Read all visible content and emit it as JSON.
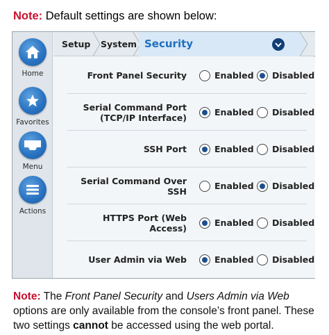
{
  "top_note": {
    "label": "Note:",
    "text": " Default settings are shown below:"
  },
  "sidebar": {
    "items": [
      {
        "label": "Home",
        "icon": "home-icon"
      },
      {
        "label": "Favorites",
        "icon": "star-icon"
      },
      {
        "label": "Menu",
        "icon": "menu-icon"
      },
      {
        "label": "Actions",
        "icon": "list-icon"
      }
    ]
  },
  "breadcrumb": {
    "setup": "Setup",
    "system": "System",
    "current": "Security"
  },
  "settings": {
    "rows": [
      {
        "label": "Front Panel Security",
        "enabled": "Enabled",
        "disabled": "Disabled",
        "selected": "disabled"
      },
      {
        "label": "Serial Command Port (TCP/IP Interface)",
        "enabled": "Enabled",
        "disabled": "Disabled",
        "selected": "enabled"
      },
      {
        "label": "SSH Port",
        "enabled": "Enabled",
        "disabled": "Disabled",
        "selected": "enabled"
      },
      {
        "label": "Serial Command Over SSH",
        "enabled": "Enabled",
        "disabled": "Disabled",
        "selected": "disabled"
      },
      {
        "label": "HTTPS Port (Web Access)",
        "enabled": "Enabled",
        "disabled": "Disabled",
        "selected": "enabled"
      },
      {
        "label": "User Admin via Web",
        "enabled": "Enabled",
        "disabled": "Disabled",
        "selected": "enabled"
      }
    ]
  },
  "bottom_note": {
    "label": "Note:",
    "t1": " The ",
    "em1": "Front Panel Security",
    "t2": " and ",
    "em2": "Users Admin via Web",
    "t3": " options are only available from the console’s front panel. These two settings ",
    "strong": "cannot",
    "t4": " be accessed using the web portal."
  },
  "colors": {
    "note_red": "#c8102e",
    "accent_blue": "#1d6fbf",
    "icon_blue": "#2a74c2"
  }
}
